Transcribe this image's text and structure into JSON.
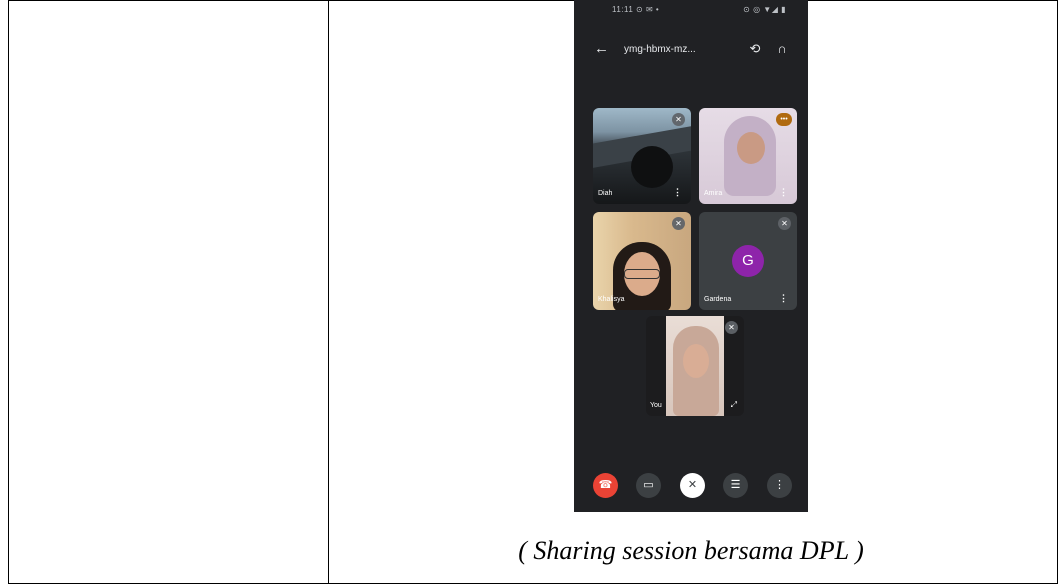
{
  "phone": {
    "status_time": "11:11 ⊙ ✉ •",
    "status_icons": "⊙ ◎ ▼◢ ▮",
    "meeting_code": "ymg-hbmx-mz...",
    "icons": {
      "back": "arrow-left-icon",
      "switch_camera": "switch-camera-icon",
      "audio": "headphones-icon"
    },
    "participants": [
      {
        "name": "Diah"
      },
      {
        "name": "Amira"
      },
      {
        "name": "Khalisya"
      },
      {
        "name": "Gardena",
        "initial": "G",
        "avatar_color": "#8e24aa"
      },
      {
        "name": "You"
      }
    ],
    "controls": [
      "end-call-icon",
      "camera-icon",
      "mic-off-icon",
      "captions-icon",
      "more-options-icon"
    ],
    "colors": {
      "background": "#202124",
      "end_call": "#ea4335"
    }
  },
  "caption": "( Sharing session bersama DPL )"
}
